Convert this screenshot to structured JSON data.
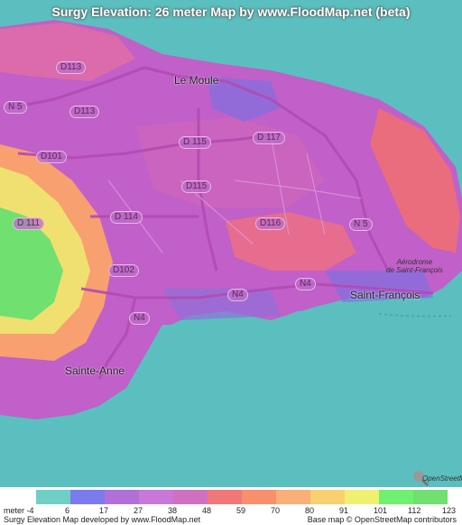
{
  "title": "Surgy Elevation: 26 meter Map by www.FloodMap.net (beta)",
  "places": {
    "le_moule": "Le Moule",
    "saint_francois": "Saint-François",
    "sainte_anne": "Sainte-Anne"
  },
  "aerodrome": {
    "line1": "Aérodrome",
    "line2": "de Saint-François"
  },
  "roads": {
    "d113a": "D113",
    "n5a": "N 5",
    "d113b": "D113",
    "d101": "D101",
    "d115a": "D 115",
    "d117": "D 117",
    "d115b": "D115",
    "d114": "D 114",
    "d116": "D116",
    "d111": "D 111",
    "d102": "D102",
    "n4a": "N4",
    "n4b": "N4",
    "n4c": "N4",
    "n5b": "N 5"
  },
  "osm_logo": "OpenStreetMap",
  "legend": {
    "colors": [
      "#6fcfc6",
      "#7b7bef",
      "#b070d8",
      "#c878d8",
      "#d070c0",
      "#f07878",
      "#f8906c",
      "#f8b078",
      "#f8d070",
      "#f0f070",
      "#70f070",
      "#70e070"
    ],
    "labels": [
      "meter -4",
      "6",
      "17",
      "27",
      "38",
      "48",
      "59",
      "70",
      "80",
      "91",
      "101",
      "112",
      "123"
    ]
  },
  "footer": {
    "left": "Surgy Elevation Map developed by www.FloodMap.net",
    "right": "Base map © OpenStreetMap contributors"
  }
}
